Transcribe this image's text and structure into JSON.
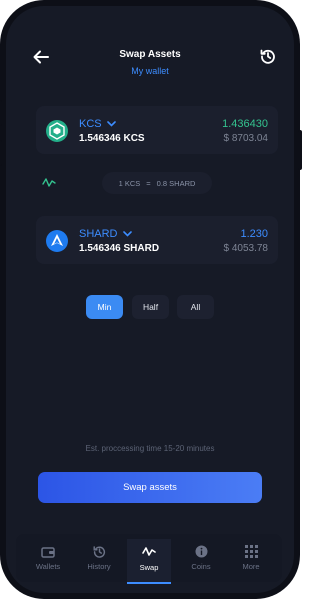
{
  "header": {
    "title": "Swap Assets",
    "subtitle": "My wallet"
  },
  "from_asset": {
    "symbol": "KCS",
    "amount": "1.546346 KCS",
    "value": "1.436430",
    "fiat": "$ 8703.04",
    "value_color": "#34c38f",
    "icon": "kucoin-icon"
  },
  "rate": {
    "from": "1 KCS",
    "equals": "=",
    "to": "0.8 SHARD"
  },
  "to_asset": {
    "symbol": "SHARD",
    "amount": "1.546346 SHARD",
    "value": "1.230",
    "fiat": "$ 4053.78",
    "value_color": "#3d8dff",
    "icon": "shard-icon"
  },
  "amount_options": [
    {
      "label": "Min",
      "active": true
    },
    {
      "label": "Half",
      "active": false
    },
    {
      "label": "All",
      "active": false
    }
  ],
  "processing_note": "Est. proccessing time 15-20 minutes",
  "swap_button": "Swap assets",
  "nav": [
    {
      "label": "Wallets",
      "icon": "wallet-icon",
      "active": false
    },
    {
      "label": "History",
      "icon": "history-icon",
      "active": false
    },
    {
      "label": "Swap",
      "icon": "swap-icon",
      "active": true
    },
    {
      "label": "Coins",
      "icon": "info-icon",
      "active": false
    },
    {
      "label": "More",
      "icon": "grid-icon",
      "active": false
    }
  ],
  "colors": {
    "accent": "#3d8dff",
    "background": "#161a26",
    "card": "#1b1f2d",
    "positive": "#34c38f"
  }
}
